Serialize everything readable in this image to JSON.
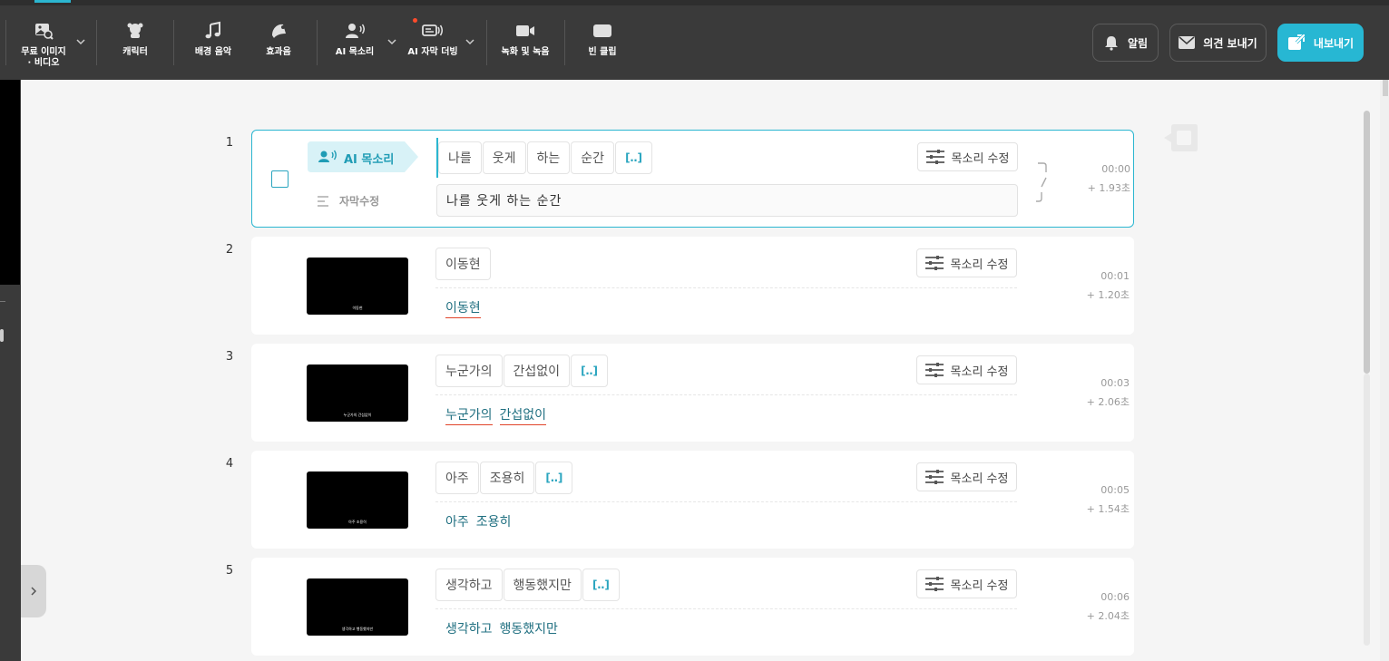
{
  "toolbar": {
    "items": [
      {
        "label1": "무료 이미지",
        "label2": "· 비디오"
      },
      {
        "label": "캐릭터"
      },
      {
        "label": "배경 음악"
      },
      {
        "label": "효과음"
      },
      {
        "label": "AI 목소리"
      },
      {
        "label": "AI 자막 더빙"
      },
      {
        "label": "녹화 및 녹음"
      },
      {
        "label": "빈 클립"
      }
    ],
    "alert_label": "알림",
    "feedback_label": "의견 보내기",
    "export_label": "내보내기",
    "accent": "#27b7d3"
  },
  "clips": [
    {
      "num": "1",
      "tag": "AI 목소리",
      "edit_label": "자막수정",
      "chips": [
        "나를",
        "웃게",
        "하는",
        "순간",
        "[‥]"
      ],
      "input": "나를 웃게 하는 순간",
      "voice_btn": "목소리 수정",
      "time": "00:00",
      "dur": "+  1.93초"
    },
    {
      "num": "2",
      "thumb": "이동현",
      "chips": [
        "이동현"
      ],
      "subs": [
        "이동현"
      ],
      "voice_btn": "목소리 수정",
      "time": "00:01",
      "dur": "+  1.20초"
    },
    {
      "num": "3",
      "thumb": "누군가의 간섭없이",
      "chips": [
        "누군가의",
        "간섭없이",
        "[‥]"
      ],
      "subs": [
        "누군가의",
        "간섭없이"
      ],
      "voice_btn": "목소리 수정",
      "time": "00:03",
      "dur": "+  2.06초"
    },
    {
      "num": "4",
      "thumb": "아주 조용히",
      "chips": [
        "아주",
        "조용히",
        "[‥]"
      ],
      "subs": [
        "아주",
        "조용히"
      ],
      "voice_btn": "목소리 수정",
      "time": "00:05",
      "dur": "+  1.54초"
    },
    {
      "num": "5",
      "thumb": "생각하고 행동했지만",
      "chips": [
        "생각하고",
        "행동했지만",
        "[‥]"
      ],
      "subs": [
        "생각하고",
        "행동했지만"
      ],
      "voice_btn": "목소리 수정",
      "time": "00:06",
      "dur": "+  2.04초"
    }
  ]
}
